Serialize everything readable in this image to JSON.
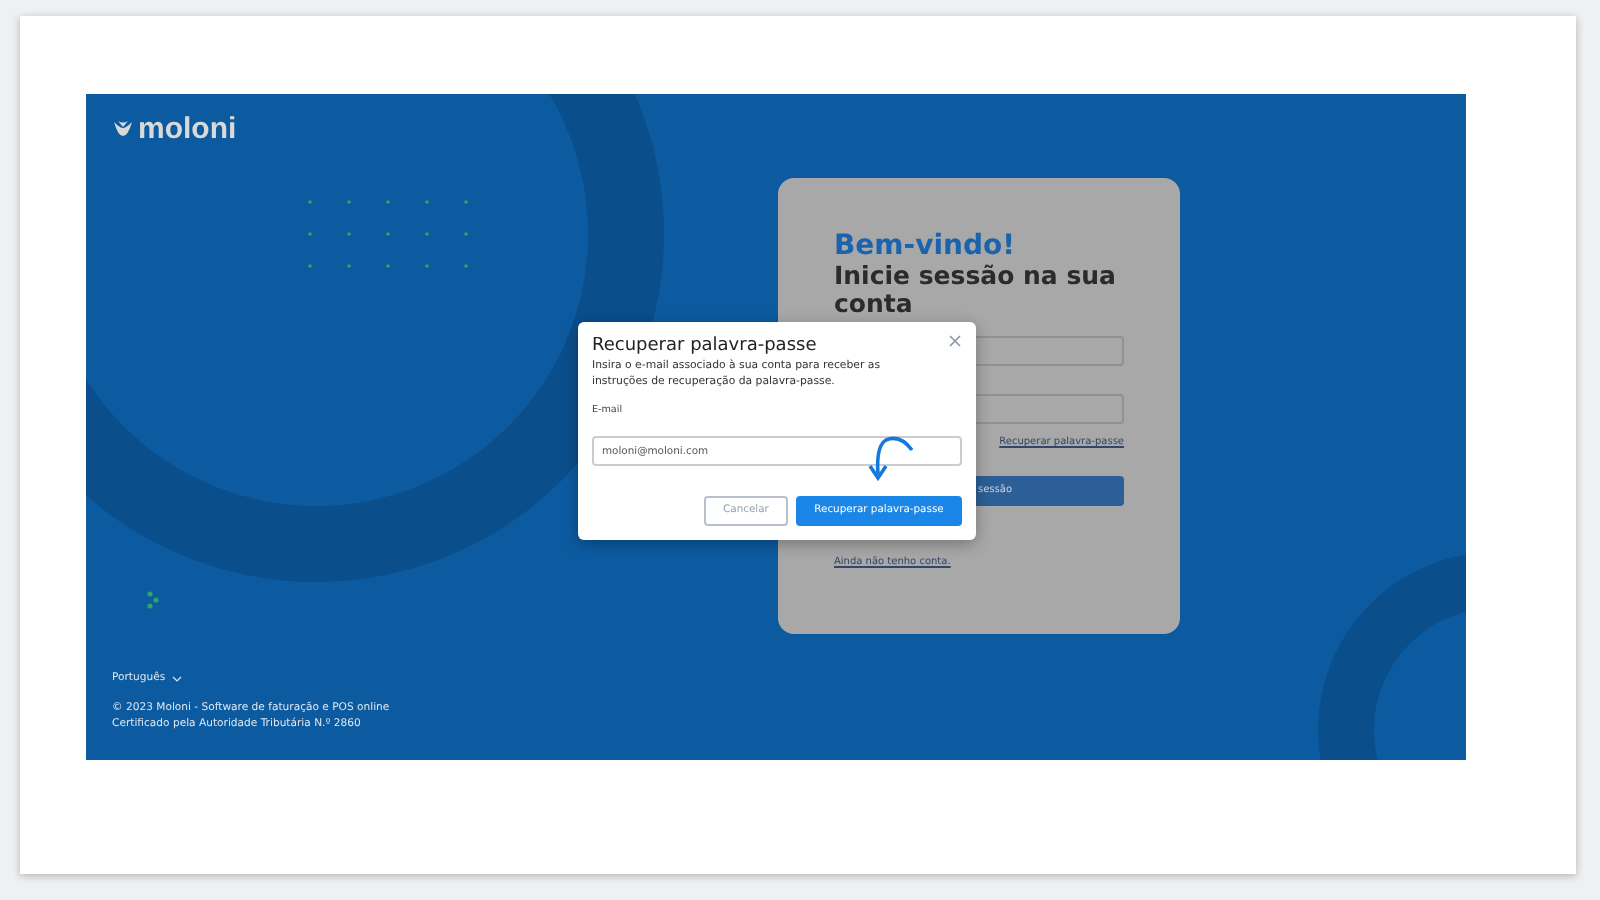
{
  "brand": {
    "name": "moloni"
  },
  "footer": {
    "language": "Português",
    "copyright": "© 2023 Moloni - Software de faturação e POS online",
    "certificate": "Certificado pela Autoridade Tributária N.º 2860"
  },
  "login": {
    "welcome": "Bem-vindo!",
    "heading": "Inicie sessão na sua conta",
    "forgot_link": "Recuperar palavra-passe",
    "submit_visible": "sessão",
    "signup_link": "Ainda não tenho conta."
  },
  "modal": {
    "title": "Recuperar palavra-passe",
    "description": "Insira o e-mail associado à sua conta para receber as instruções de recuperação da palavra-passe.",
    "field_label": "E-mail",
    "field_value": "moloni@moloni.com",
    "buttons": [
      {
        "label": "Cancelar",
        "kind": "secondary"
      },
      {
        "label": "Recuperar palavra-passe",
        "kind": "primary"
      }
    ]
  }
}
